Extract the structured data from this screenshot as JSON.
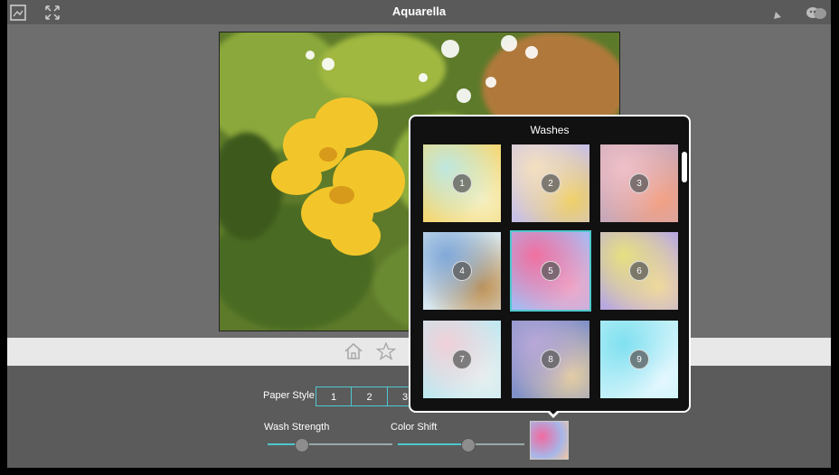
{
  "app": {
    "title": "Aquarella"
  },
  "toolbar": {
    "left_icons": [
      "image-icon",
      "fullscreen-icon"
    ],
    "right_icons": [
      "undo-icon",
      "masks-icon"
    ]
  },
  "nav": {
    "icons": [
      "home-icon",
      "star-icon"
    ]
  },
  "controls": {
    "paper_style_label": "Paper Style",
    "paper_style_options": [
      "1",
      "2",
      "3"
    ],
    "wash_strength_label": "Wash Strength",
    "wash_strength_value": 0.27,
    "color_shift_label": "Color Shift",
    "color_shift_value": 0.55
  },
  "washes": {
    "title": "Washes",
    "selected": "5",
    "tiles": [
      {
        "number": "1",
        "colors": [
          "#bfe8e0",
          "#f3d774",
          "#f7f0c0"
        ]
      },
      {
        "number": "2",
        "colors": [
          "#f4e0c0",
          "#c8c0e8",
          "#f0d060"
        ]
      },
      {
        "number": "3",
        "colors": [
          "#f0c0c8",
          "#c8a8b8",
          "#f4a080"
        ]
      },
      {
        "number": "4",
        "colors": [
          "#80a8d8",
          "#d8e8f0",
          "#c09050"
        ]
      },
      {
        "number": "5",
        "colors": [
          "#f070a0",
          "#a8b8f0",
          "#f0a8c8"
        ]
      },
      {
        "number": "6",
        "colors": [
          "#e8e080",
          "#b8a8e0",
          "#f0d8a0"
        ]
      },
      {
        "number": "7",
        "colors": [
          "#f0d0d8",
          "#c0e8f0",
          "#e8f0f0"
        ]
      },
      {
        "number": "8",
        "colors": [
          "#b8a8d8",
          "#8090c8",
          "#e8d0a0"
        ]
      },
      {
        "number": "9",
        "colors": [
          "#80e0f0",
          "#c0f0f8",
          "#e8f8ff"
        ]
      }
    ]
  }
}
